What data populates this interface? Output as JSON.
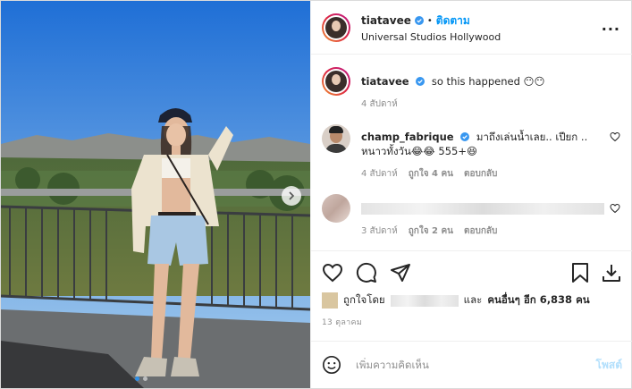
{
  "post": {
    "author": "tiatavee",
    "follow_label": "ติดตาม",
    "separator": "•",
    "location": "Universal Studios Hollywood",
    "more_label": "···",
    "photo_dots": 2,
    "photo_index": 1
  },
  "comments": [
    {
      "user": "tiatavee",
      "text": "so this happened 😶😶",
      "time": "4 สัปดาห์"
    },
    {
      "user": "champ_fabrique",
      "text": "มาถึงเล่นน้ำเลย.. เปียก .. หนาวทั้งวัน😂😂 555+😆",
      "time": "4 สัปดาห์",
      "likes": "ถูกใจ 4 คน",
      "reply": "ตอบกลับ"
    },
    {
      "user": "",
      "text": "",
      "time": "3 สัปดาห์",
      "likes": "ถูกใจ 2 คน",
      "reply": "ตอบกลับ"
    }
  ],
  "likes_line": {
    "prefix": "ถูกใจโดย",
    "suffix_and": "และ",
    "suffix_others": "คนอื่นๆ อีก 6,838 คน"
  },
  "date": "13 ตุลาคม",
  "add_comment": {
    "placeholder": "เพิ่มความคิดเห็น",
    "post_label": "โพสต์"
  },
  "colors": {
    "accent": "#0095f6",
    "verified": "#3897f0",
    "sky_top": "#1f6fd6",
    "sky_bottom": "#8fc3ee"
  },
  "icons": [
    "more-icon",
    "verified-icon",
    "heart-icon",
    "comment-icon",
    "share-icon",
    "bookmark-icon",
    "save-download-icon",
    "emoji-icon",
    "next-arrow-icon"
  ]
}
